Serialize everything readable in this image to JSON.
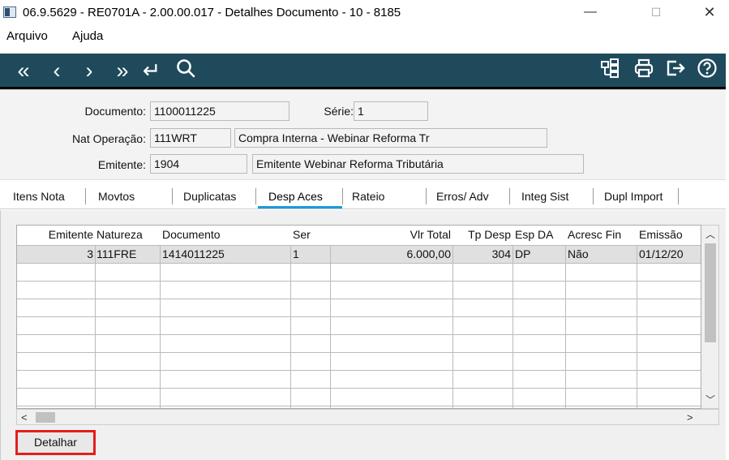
{
  "window": {
    "title": "06.9.5629 - RE0701A - 2.00.00.017 - Detalhes Documento - 10 - 8185",
    "minimize": "—",
    "maximize": "☐",
    "close": "✕"
  },
  "menu": {
    "file": "Arquivo",
    "help": "Ajuda"
  },
  "toolbar": {
    "icons": [
      "first-icon",
      "prev-icon",
      "next-icon",
      "last-icon",
      "return-icon",
      "search-icon",
      "structure-icon",
      "print-icon",
      "exit-icon",
      "help-icon"
    ],
    "glyphs": {
      "first": "«",
      "prev": "‹",
      "next": "›",
      "last": "»",
      "return": "↵",
      "search": "⚲",
      "structure": "⊞",
      "print": "⎙",
      "exit": "⇥",
      "help": "?"
    }
  },
  "form": {
    "documento_label": "Documento:",
    "documento_value": "1100011225",
    "serie_label": "Série:",
    "serie_value": "1",
    "nat_label": "Nat Operação:",
    "nat_code": "111WRT",
    "nat_desc": "Compra Interna - Webinar Reforma Tr",
    "emitente_label": "Emitente:",
    "emitente_code": "1904",
    "emitente_name": "Emitente Webinar Reforma Tributária"
  },
  "tabs": [
    "Itens Nota",
    "Movtos",
    "Duplicatas",
    "Desp Aces",
    "Rateio",
    "Erros/ Adv",
    "Integ Sist",
    "Dupl Import"
  ],
  "active_tab": "Desp Aces",
  "grid": {
    "headers": [
      "Emitente",
      "Natureza",
      "Documento",
      "Ser",
      "Vlr Total",
      "Tp Desp",
      "Esp DA",
      "Acresc Fin",
      "Emissão"
    ],
    "rows": [
      [
        "3",
        "111FRE",
        "1414011225",
        "1",
        "6.000,00",
        "304",
        "DP",
        "Não",
        "01/12/20"
      ]
    ]
  },
  "buttons": {
    "detalhar": "Detalhar"
  },
  "colors": {
    "toolbar": "#1f4a5c",
    "tab_underline": "#1b9bd7",
    "highlight": "#e31e1e"
  }
}
